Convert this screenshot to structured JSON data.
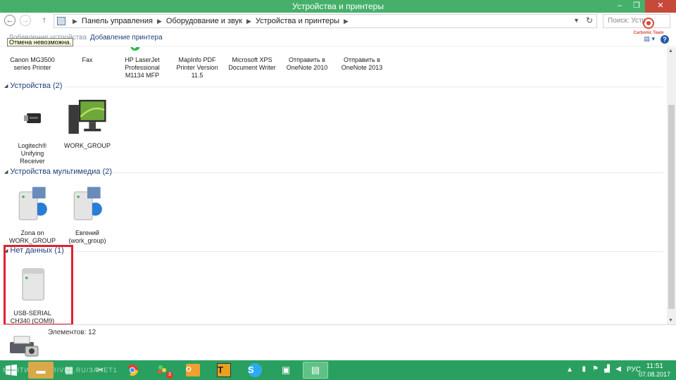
{
  "window": {
    "title": "Устройства и принтеры",
    "minimize": "‒",
    "maximize": "❐",
    "close": "✕"
  },
  "address": {
    "crumbs": [
      "Панель управления",
      "Оборудование и звук",
      "Устройства и принтеры"
    ],
    "search_placeholder": "Поиск: Устр..."
  },
  "toolbar": {
    "add_device": "Добавление устройства",
    "add_printer": "Добавление принтера",
    "tooltip": "Отмена невозможна."
  },
  "watermark": "Carbonic Team",
  "printers": [
    {
      "label": "Canon MG3500\nseries Printer",
      "icon": "printer-icon"
    },
    {
      "label": "Fax",
      "icon": "fax-icon"
    },
    {
      "label": "HP LaserJet\nProfessional\nM1134 MFP",
      "icon": "default-printer-icon"
    },
    {
      "label": "MapInfo PDF\nPrinter Version\n11.5",
      "icon": "printer-icon"
    },
    {
      "label": "Microsoft XPS\nDocument Writer",
      "icon": "printer-icon"
    },
    {
      "label": "Отправить в\nOneNote 2010",
      "icon": "printer-icon"
    },
    {
      "label": "Отправить в\nOneNote 2013",
      "icon": "printer-icon"
    }
  ],
  "groups": {
    "devices": {
      "title": "Устройства (2)"
    },
    "multimedia": {
      "title": "Устройства мультимедиа (2)"
    },
    "unspecified": {
      "title": "Нет данных (1)"
    }
  },
  "devices": [
    {
      "label": "Logitech®\nUnifying\nReceiver",
      "icon": "usb-receiver-icon"
    },
    {
      "label": "WORK_GROUP",
      "icon": "computer-icon"
    }
  ],
  "multimedia": [
    {
      "label": "Zona on\nWORK_GROUP",
      "icon": "media-server-icon"
    },
    {
      "label": "Евгений\n(work_group)",
      "icon": "media-server-icon"
    }
  ],
  "unspecified": [
    {
      "label": "USB-SERIAL\nCH340 (COM9)",
      "icon": "generic-device-icon"
    }
  ],
  "details": {
    "count": "Элементов: 12"
  },
  "taskbar": {
    "watermark_text": "МОНТИКАЛ.DRIVE2.RU/ЗАНЕТ1",
    "apps": [
      "file-explorer-icon",
      "calculator-icon",
      "scissors-icon",
      "chrome-icon",
      "game-icon",
      "outlook-icon",
      "total-commander-icon",
      "skype-icon",
      "network-icon",
      "devices-printers-icon"
    ],
    "badge": "3",
    "lang": "РУС",
    "time": "11:51",
    "date": "07.08.2017"
  },
  "colors": {
    "titlebar": "#46b06a",
    "taskbar": "#2aa060",
    "highlight": "#e2202f",
    "group_header": "#1e3f7a"
  }
}
